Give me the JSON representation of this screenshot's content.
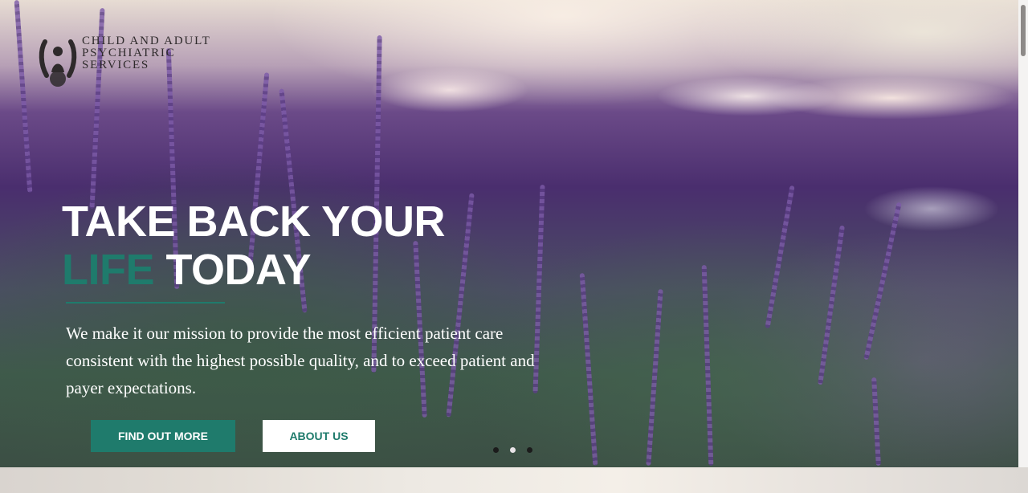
{
  "logo": {
    "lines": [
      "CHILD AND ADULT",
      "PSYCHIATRIC",
      "SERVICES"
    ]
  },
  "hero": {
    "headline_line1": "TAKE BACK YOUR",
    "headline_accent": "LIFE",
    "headline_rest": " TODAY",
    "mission_text": "We make it our mission to provide the most efficient patient care consistent with the highest possible quality, and to exceed patient and payer expectations.",
    "primary_button": "FIND OUT MORE",
    "secondary_button": "ABOUT US"
  },
  "slider": {
    "dot_count": 3,
    "active_index": 1
  },
  "colors": {
    "accent": "#1f7b6c",
    "text_light": "#ffffff",
    "logo_text": "#2e2a2b"
  }
}
